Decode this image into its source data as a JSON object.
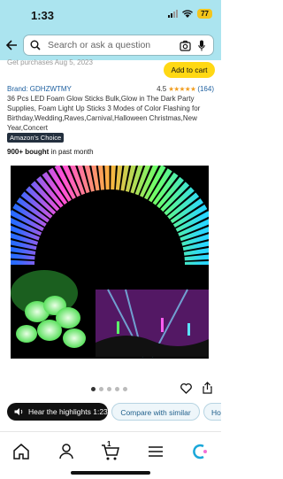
{
  "status": {
    "time": "1:33",
    "battery": "77"
  },
  "search": {
    "placeholder": "Search or ask a question"
  },
  "strip": {
    "partial_text": "Get purchases Aug 5, 2023",
    "add_to_cart": "Add to cart"
  },
  "product": {
    "brand": "Brand: GDHZWTMY",
    "rating": "4.5",
    "stars": "★★★★★",
    "review_count": "(164)",
    "title": "36 Pcs LED Foam Glow Sticks Bulk,Glow in The Dark Party Supplies,   Foam Light Up Sticks 3 Modes of Color Flashing for Birthday,Wedding,Raves,Carnival,Halloween Christmas,New Year,Concert",
    "badge": "Amazon's Choice",
    "bought_bold": "900+ bought",
    "bought_rest": " in past month"
  },
  "gallery": {
    "count": 5,
    "active_index": 0
  },
  "actions": {
    "highlights": "Hear the highlights 1:23",
    "compare": "Compare with similar",
    "more": "Ho"
  },
  "bottom_nav": {
    "cart_count": "1"
  },
  "colors": {
    "header_bg": "#abe4ef",
    "cart_button": "#ffd814",
    "link": "#2162a1",
    "badge_bg": "#232f3e"
  }
}
